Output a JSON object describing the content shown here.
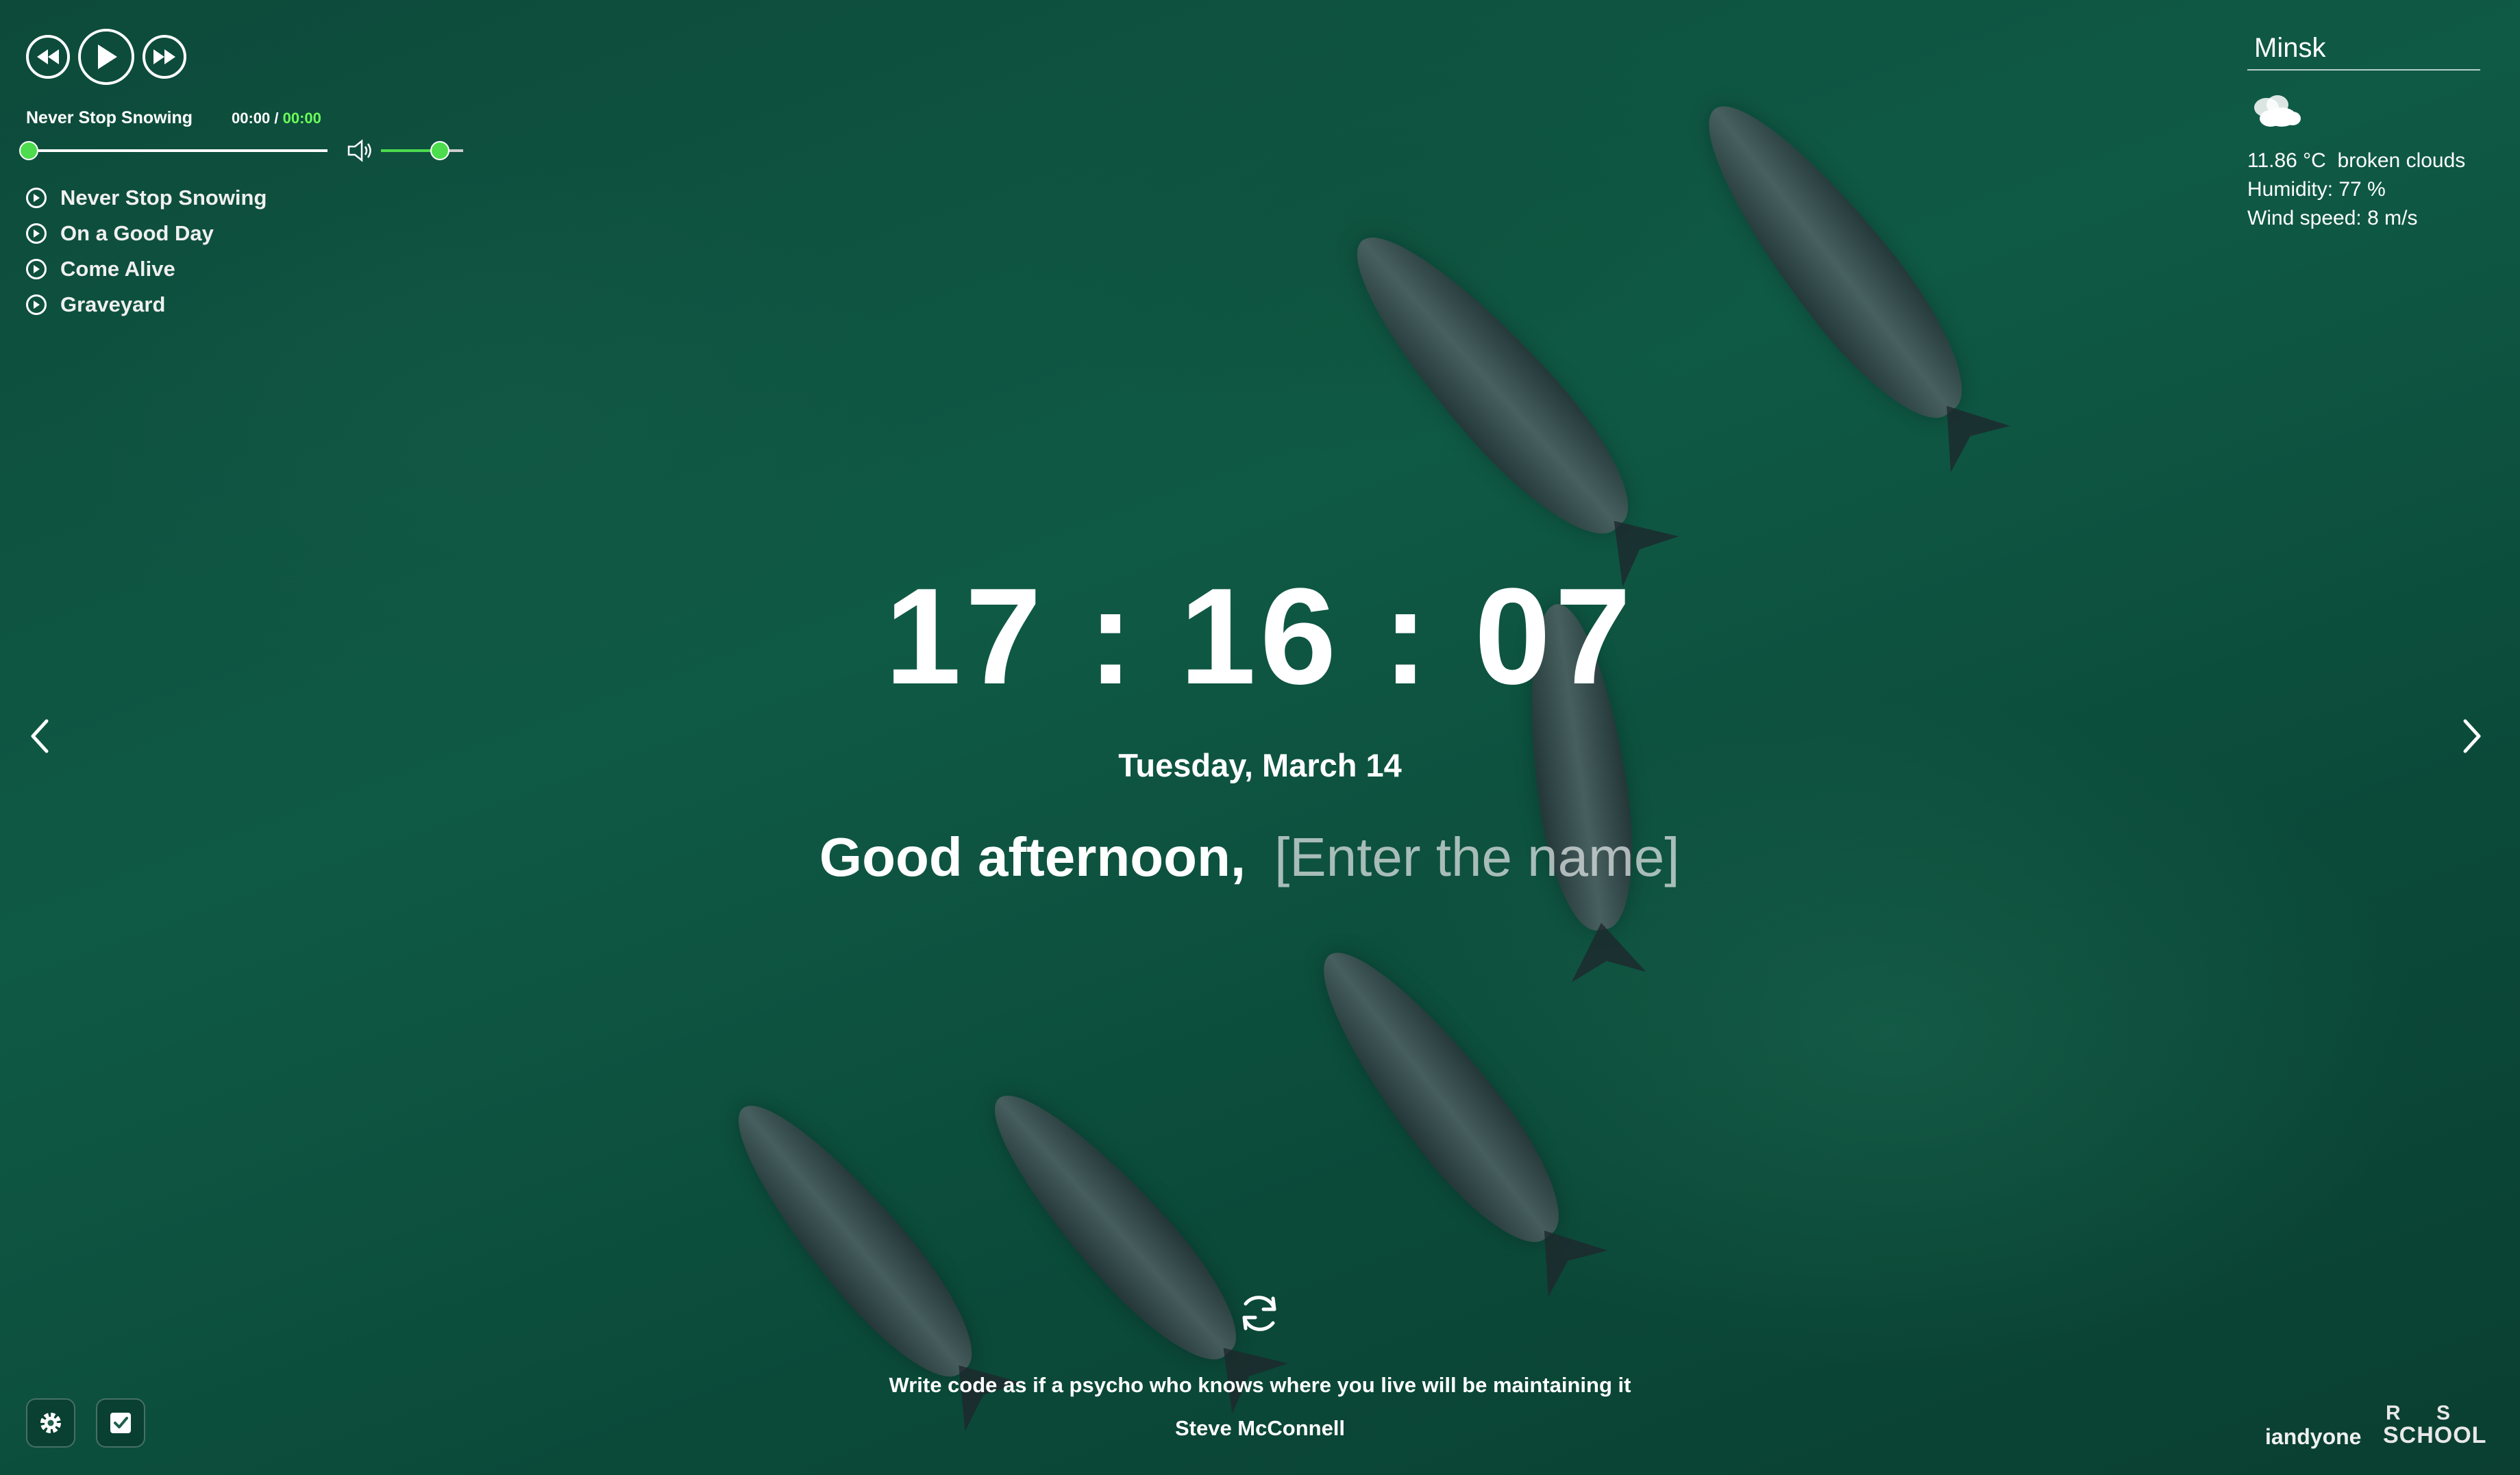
{
  "player": {
    "current_track": "Never Stop Snowing",
    "time_current": "00:00",
    "time_separator": " / ",
    "time_total": "00:00",
    "progress_fraction": 0,
    "volume_fraction": 0.7,
    "playlist": [
      {
        "title": "Never Stop Snowing"
      },
      {
        "title": "On a Good Day"
      },
      {
        "title": "Come Alive"
      },
      {
        "title": "Graveyard"
      }
    ]
  },
  "weather": {
    "city": "Minsk",
    "icon": "broken-clouds-icon",
    "temperature": "11.86 °C  broken clouds",
    "humidity": "Humidity: 77 %",
    "wind": "Wind speed: 8 m/s"
  },
  "clock": {
    "time": "17:16:07"
  },
  "date": "Tuesday, March 14",
  "greeting": {
    "text": "Good afternoon,",
    "name_placeholder": "[Enter the name]",
    "name_value": ""
  },
  "quote": {
    "text": "Write code as if a psycho who knows where you live will be maintaining it",
    "author": "Steve McConnell"
  },
  "footer": {
    "author_link": "iandyone",
    "logo_text": "RS SCHOOL"
  },
  "colors": {
    "accent_green": "#4ddc4d",
    "time_total_green": "#6bff5a",
    "background_sea": "#0f5a45"
  }
}
